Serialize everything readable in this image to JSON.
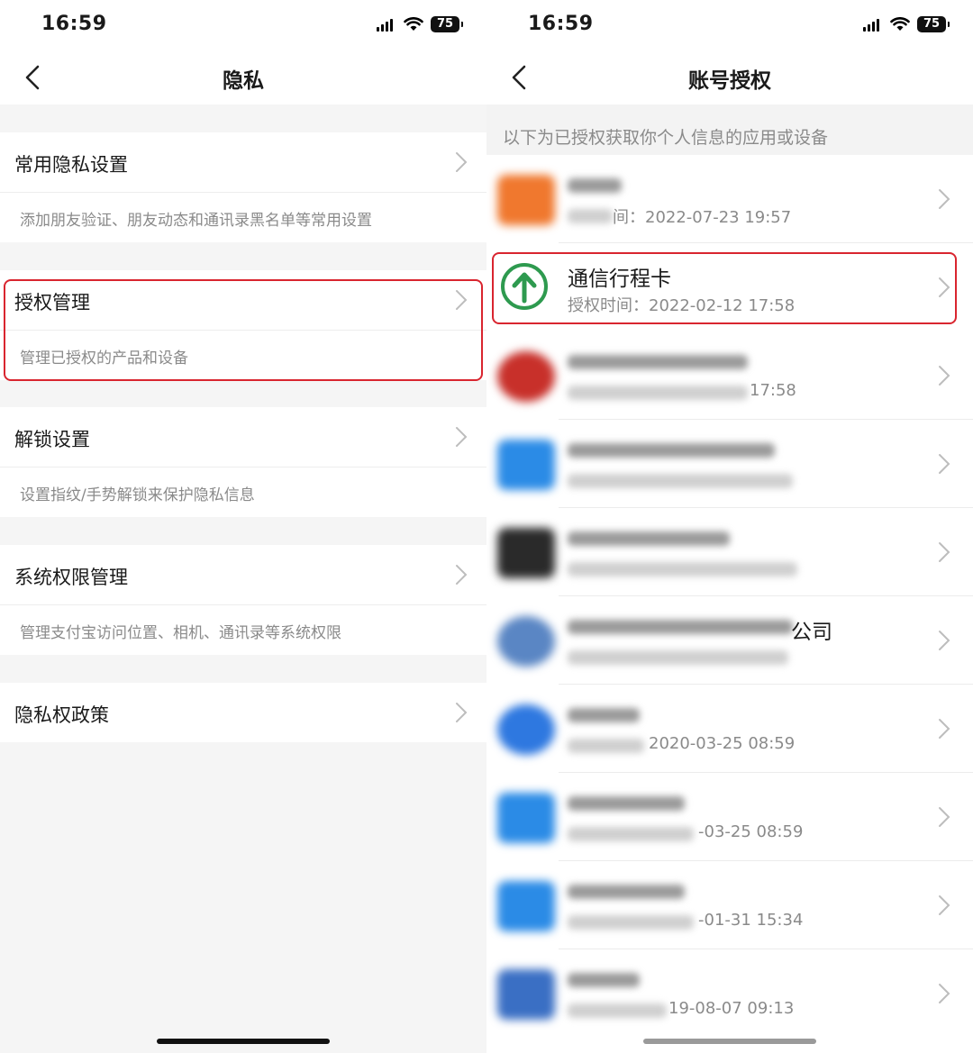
{
  "status_bar": {
    "time": "16:59",
    "battery": "75"
  },
  "left": {
    "title": "隐私",
    "sections": [
      {
        "title": "常用隐私设置",
        "desc": "添加朋友验证、朋友动态和通讯录黑名单等常用设置"
      },
      {
        "title": "授权管理",
        "desc": "管理已授权的产品和设备"
      },
      {
        "title": "解锁设置",
        "desc": "设置指纹/手势解锁来保护隐私信息"
      },
      {
        "title": "系统权限管理",
        "desc": "管理支付宝访问位置、相机、通讯录等系统权限"
      },
      {
        "title": "隐私权政策",
        "desc": ""
      }
    ]
  },
  "right": {
    "title": "账号授权",
    "caption": "以下为已授权获取你个人信息的应用或设备",
    "apps": [
      {
        "name": "",
        "time": "间：2022-07-23 19:57",
        "logo_color": "#f0782e"
      },
      {
        "name": "通信行程卡",
        "time": "授权时间：2022-02-12 17:58",
        "logo_color": "#2e9a4f"
      },
      {
        "name": "",
        "time": "17:58",
        "logo_color": "#c8302a"
      },
      {
        "name": "",
        "time": "",
        "logo_color": "#2b8be6"
      },
      {
        "name": "",
        "time": "",
        "logo_color": "#2a2a2a"
      },
      {
        "name": "公司",
        "time": "",
        "logo_color": "#5a86c4"
      },
      {
        "name": "",
        "time": "2020-03-25 08:59",
        "logo_color": "#2e78e0"
      },
      {
        "name": "",
        "time": "-03-25 08:59",
        "logo_color": "#2b8be6"
      },
      {
        "name": "",
        "time": "-01-31 15:34",
        "logo_color": "#2b8be6"
      },
      {
        "name": "",
        "time": "19-08-07 09:13",
        "logo_color": "#3a6fc4"
      }
    ]
  },
  "colors": {
    "highlight": "#d9252f",
    "secondary_text": "#8a8a8a",
    "background": "#f5f5f5"
  }
}
